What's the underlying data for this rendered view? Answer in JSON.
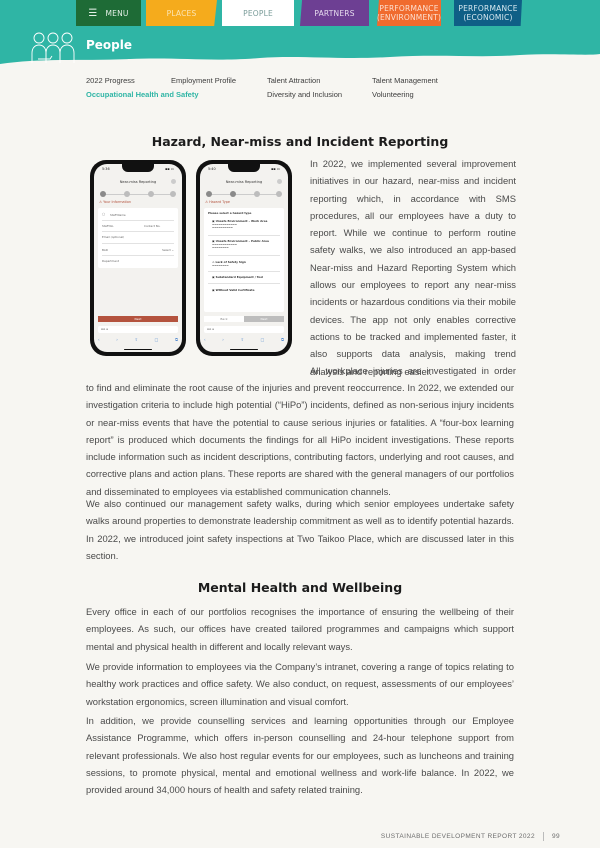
{
  "nav": {
    "menu_label": "MENU",
    "tabs": [
      {
        "label": "PLACES",
        "color": "#f5ab1c"
      },
      {
        "label": "PEOPLE",
        "color": "#ffffff",
        "active": true
      },
      {
        "label": "PARTNERS",
        "color": "#6d3f93"
      },
      {
        "label": "PERFORMANCE (ENVIRONMENT)",
        "line1": "PERFORMANCE",
        "line2": "(ENVIRONMENT)",
        "color": "#f06b2e"
      },
      {
        "label": "PERFORMANCE (ECONOMIC)",
        "line1": "PERFORMANCE",
        "line2": "(ECONOMIC)",
        "color": "#0f5f86"
      }
    ]
  },
  "header": {
    "section_title": "People",
    "icon": "people-group-icon",
    "band_color": "#2fb5a5"
  },
  "subnav": {
    "items": [
      {
        "label": "2022 Progress"
      },
      {
        "label": "Employment Profile"
      },
      {
        "label": "Talent Attraction"
      },
      {
        "label": "Talent Management"
      },
      {
        "label": "Occupational Health and Safety",
        "active": true
      },
      {
        "label": "Diversity and Inclusion"
      },
      {
        "label": "Volunteering"
      }
    ]
  },
  "section1": {
    "heading": "Hazard, Near-miss and Incident Reporting",
    "intro": "In 2022, we implemented several improvement initiatives in our hazard, near-miss and incident reporting which, in accordance with SMS procedures, all our employees have a duty to report. While we continue to perform routine safety walks, we also introduced an app-based Near-miss and Hazard Reporting System which allows our employees to report any near-miss incidents or hazardous conditions via their mobile devices. The app not only enables corrective actions to be tracked and implemented faster, it also supports data analysis, making trend analysis and reporting easier.",
    "para2_start": "All workplace injuries are investigated in order",
    "para2_rest": "to find and eliminate the root cause of the injuries and prevent reoccurrence. In 2022, we extended our investigation criteria to include high potential (“HiPo”) incidents, defined as non-serious injury incidents or near-miss events that have the potential to cause serious injuries or fatalities. A “four-box learning report” is produced which documents the findings for all HiPo incident investigations. These reports include information such as incident descriptions, contributing factors, underlying and root causes, and corrective plans and action plans. These reports are shared with the general managers of our portfolios and disseminated to employees via established communication channels.",
    "para3": "We also continued our management safety walks, during which senior employees undertake safety walks around properties to demonstrate leadership commitment as well as to identify potential hazards. In 2022, we introduced joint safety inspections at Two Taikoo Place, which are discussed later in this section."
  },
  "phone1": {
    "time": "5:36",
    "app_title": "Near-miss Reporting",
    "step_label": "Your Information",
    "staff_label": "Staff Name",
    "field1": "Staff No.",
    "field2": "Contact No.",
    "field3": "Email (optional)",
    "field4": "BAR",
    "field4_value": "Select",
    "field5": "Department",
    "button": "Next",
    "url": "AA  a"
  },
  "phone2": {
    "time": "5:40",
    "app_title": "Near-miss Reporting",
    "step_label": "Hazard Type",
    "prompt": "Please select a hazard type",
    "hazards": [
      "Unsafe Environment – Work Area",
      "Unsafe Environment – Public Area",
      "Lack of Safety Sign",
      "Substandard Equipment / Tool",
      "Without Valid Certificate"
    ],
    "back": "Back",
    "next": "Next",
    "url": "AA  a"
  },
  "section2": {
    "heading": "Mental Health and Wellbeing",
    "para1": "Every office in each of our portfolios recognises the importance of ensuring the wellbeing of their employees. As such, our offices have created tailored programmes and campaigns which support mental and physical health in different and locally relevant ways.",
    "para2": "We provide information to employees via the Company’s intranet, covering a range of topics relating to healthy work practices and office safety. We also conduct, on request, assessments of our employees’ workstation ergonomics, screen illumination and visual comfort.",
    "para3": "In addition, we provide counselling services and learning opportunities through our Employee Assistance Programme, which offers in-person counselling and 24-hour telephone support from relevant professionals. We also host regular events for our employees, such as luncheons and training sessions, to promote physical, mental and emotional wellness and work-life balance. In 2022, we provided around 34,000 hours of health and safety related training."
  },
  "footer": {
    "report_title": "SUSTAINABLE DEVELOPMENT REPORT 2022",
    "page_number": "99"
  }
}
